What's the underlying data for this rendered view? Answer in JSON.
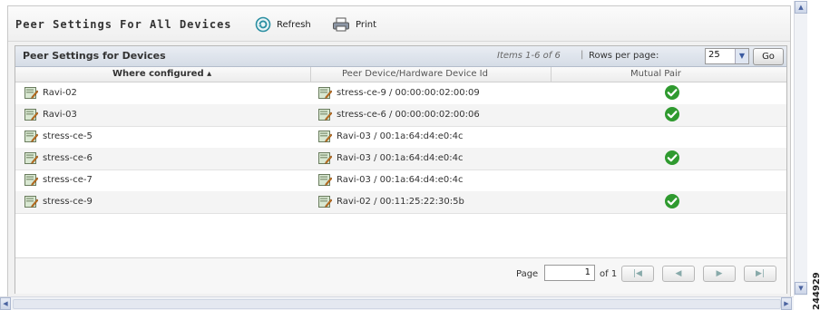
{
  "toolbar": {
    "title": "Peer Settings For All Devices",
    "refresh_label": "Refresh",
    "print_label": "Print"
  },
  "table": {
    "title": "Peer Settings for Devices",
    "items_text": "Items 1-6 of 6",
    "separator": "|",
    "rows_per_page_label": "Rows per page:",
    "rows_per_page_value": "25",
    "go_label": "Go",
    "columns": [
      "Where configured ▴",
      "Peer Device/Hardware Device Id",
      "Mutual Pair"
    ],
    "rows": [
      {
        "where": "Ravi-02",
        "peer": "stress-ce-9 / 00:00:00:02:00:09",
        "mutual": true
      },
      {
        "where": "Ravi-03",
        "peer": "stress-ce-6 / 00:00:00:02:00:06",
        "mutual": true
      },
      {
        "where": "stress-ce-5",
        "peer": "Ravi-03 / 00:1a:64:d4:e0:4c",
        "mutual": false
      },
      {
        "where": "stress-ce-6",
        "peer": "Ravi-03 / 00:1a:64:d4:e0:4c",
        "mutual": true
      },
      {
        "where": "stress-ce-7",
        "peer": "Ravi-03 / 00:1a:64:d4:e0:4c",
        "mutual": false
      },
      {
        "where": "stress-ce-9",
        "peer": "Ravi-02 / 00:11:25:22:30:5b",
        "mutual": true
      }
    ]
  },
  "pagination": {
    "page_label": "Page",
    "page_value": "1",
    "of_label": "of 1"
  },
  "watermark": "244929",
  "colors": {
    "check_green": "#2f9a2f",
    "header_blue": "#d5dce6"
  }
}
